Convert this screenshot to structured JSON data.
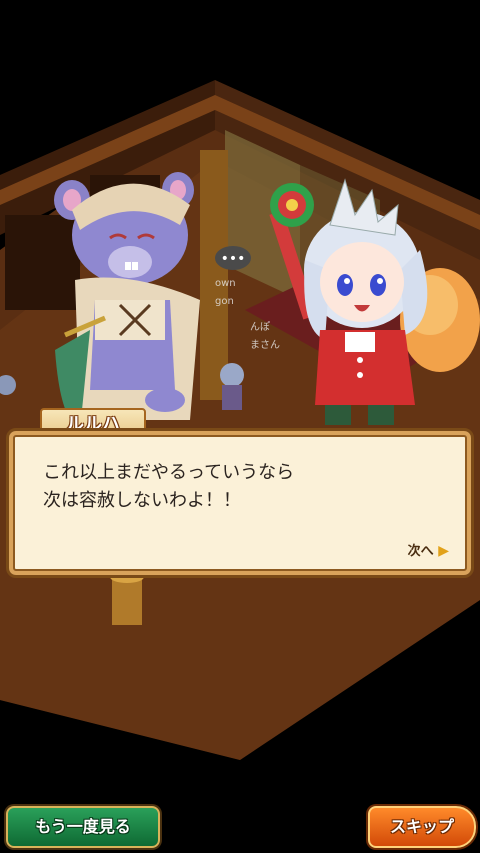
{
  "dialog": {
    "speaker": "ルルハ",
    "lines": [
      "これ以上まだやるっていうなら",
      "次は容赦しないわよ！！"
    ],
    "next_label": "次へ"
  },
  "buttons": {
    "replay_label": "もう一度見る",
    "skip_label": "スキップ"
  },
  "scene": {
    "thinking_bubble": "•••",
    "background_names": [
      "own",
      "gon",
      "んぽ",
      "まさん"
    ]
  },
  "colors": {
    "dialog_bg": "#fbf1d8",
    "dialog_border": "#7a4a17",
    "replay_button": "#1a8a45",
    "skip_button": "#f06a12"
  }
}
